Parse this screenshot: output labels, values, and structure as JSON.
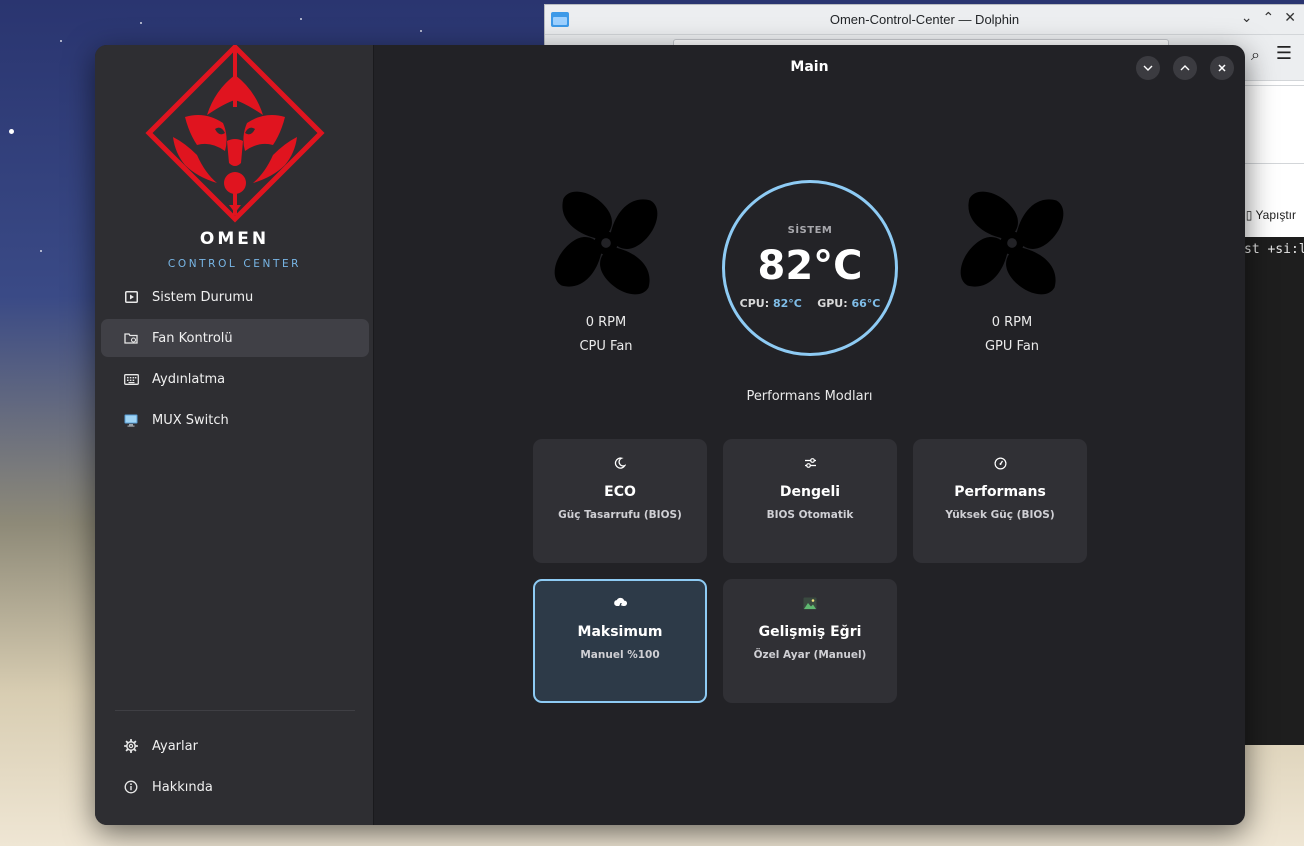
{
  "desktop": {
    "background_window": {
      "title": "Omen-Control-Center — Dolphin",
      "minimize": "⌄",
      "maximize": "⌃",
      "close": "✕",
      "paste_label": "Yapıştır",
      "terminal_text": "st +si:l"
    }
  },
  "app": {
    "brand": "OMEN",
    "brand_subtitle": "CONTROL CENTER",
    "logo_color": "#e0141f",
    "accent_color": "#8ecbf4",
    "sidebar": {
      "items": [
        {
          "label": "Sistem Durumu",
          "icon": "play-box-icon"
        },
        {
          "label": "Fan Kontrolü",
          "icon": "folder-fan-icon",
          "active": true
        },
        {
          "label": "Aydınlatma",
          "icon": "keyboard-icon"
        },
        {
          "label": "MUX Switch",
          "icon": "monitor-icon"
        }
      ],
      "footer_items": [
        {
          "label": "Ayarlar",
          "icon": "gear-icon"
        },
        {
          "label": "Hakkında",
          "icon": "info-icon"
        }
      ]
    },
    "main": {
      "title": "Main",
      "cpu_fan": {
        "rpm": "0 RPM",
        "label": "CPU Fan"
      },
      "gpu_fan": {
        "rpm": "0 RPM",
        "label": "GPU Fan"
      },
      "gauge": {
        "label": "SİSTEM",
        "temperature": "82°C",
        "cpu_label": "CPU:",
        "cpu_value": "82°C",
        "gpu_label": "GPU:",
        "gpu_value": "66°C"
      },
      "modes_title": "Performans Modları",
      "modes": [
        {
          "title": "ECO",
          "subtitle": "Güç Tasarrufu (BIOS)",
          "icon": "moon-icon"
        },
        {
          "title": "Dengeli",
          "subtitle": "BIOS Otomatik",
          "icon": "sliders-icon"
        },
        {
          "title": "Performans",
          "subtitle": "Yüksek Güç (BIOS)",
          "icon": "speedometer-icon"
        },
        {
          "title": "Maksimum",
          "subtitle": "Manuel %100",
          "icon": "storm-cloud-icon",
          "selected": true
        },
        {
          "title": "Gelişmiş Eğri",
          "subtitle": "Özel Ayar (Manuel)",
          "icon": "image-icon"
        }
      ]
    }
  }
}
